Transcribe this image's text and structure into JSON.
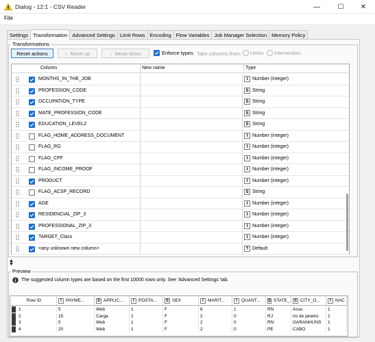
{
  "window": {
    "title": "Dialog - 12:1 - CSV Reader",
    "minimize_glyph": "—",
    "maximize_glyph": "☐",
    "close_glyph": "✕"
  },
  "menu": {
    "file": "File"
  },
  "tabs": [
    {
      "label": "Settings",
      "active": false
    },
    {
      "label": "Transformation",
      "active": true
    },
    {
      "label": "Advanced Settings",
      "active": false
    },
    {
      "label": "Limit Rows",
      "active": false
    },
    {
      "label": "Encoding",
      "active": false
    },
    {
      "label": "Flow Variables",
      "active": false
    },
    {
      "label": "Job Manager Selection",
      "active": false
    },
    {
      "label": "Memory Policy",
      "active": false
    }
  ],
  "transformations": {
    "group_label": "Transformations",
    "reset_label": "Reset actions",
    "move_up_label": "Move up",
    "move_down_label": "Move down",
    "enforce_types_label": "Enforce types",
    "enforce_types_checked": true,
    "take_columns_label": "Take columns from:",
    "union_label": "Union",
    "intersection_label": "Intersection"
  },
  "table": {
    "headers": {
      "column": "Column",
      "new_name": "New name",
      "type": "Type"
    },
    "rows": [
      {
        "checked": true,
        "column": "MONTHS_IN_THE_JOB",
        "type_icon": "I",
        "type": "Number (integer)"
      },
      {
        "checked": true,
        "column": "PROFESSION_CODE",
        "type_icon": "S",
        "type": "String"
      },
      {
        "checked": true,
        "column": "OCCUPATION_TYPE",
        "type_icon": "S",
        "type": "String"
      },
      {
        "checked": true,
        "column": "MATE_PROFESSION_CODE",
        "type_icon": "S",
        "type": "String"
      },
      {
        "checked": true,
        "column": "EDUCATION_LEVEL2",
        "type_icon": "S",
        "type": "String"
      },
      {
        "checked": false,
        "column": "FLAG_HOME_ADDRESS_DOCUMENT",
        "type_icon": "I",
        "type": "Number (integer)"
      },
      {
        "checked": false,
        "column": "FLAG_RG",
        "type_icon": "I",
        "type": "Number (integer)"
      },
      {
        "checked": false,
        "column": "FLAG_CPF",
        "type_icon": "I",
        "type": "Number (integer)"
      },
      {
        "checked": false,
        "column": "FLAG_INCOME_PROOF",
        "type_icon": "I",
        "type": "Number (integer)"
      },
      {
        "checked": true,
        "column": "PRODUCT",
        "type_icon": "I",
        "type": "Number (integer)"
      },
      {
        "checked": false,
        "column": "FLAG_ACSP_RECORD",
        "type_icon": "S",
        "type": "String"
      },
      {
        "checked": true,
        "column": "AGE",
        "type_icon": "I",
        "type": "Number (integer)"
      },
      {
        "checked": true,
        "column": "RESIDENCIAL_ZIP_3",
        "type_icon": "I",
        "type": "Number (integer)"
      },
      {
        "checked": true,
        "column": "PROFESSIONAL_ZIP_3",
        "type_icon": "I",
        "type": "Number (integer)"
      },
      {
        "checked": true,
        "column": "TARGET_Class",
        "type_icon": "I",
        "type": "Number (integer)"
      },
      {
        "checked": true,
        "column": "<any unknown new column>",
        "type_icon": "?",
        "type": "Default"
      }
    ]
  },
  "preview": {
    "group_label": "Preview",
    "info_text": "The suggested column types are based on the first 10000 rows only. See 'Advanced Settings' tab.",
    "headers": [
      {
        "icon": "",
        "label": "Row ID"
      },
      {
        "icon": "I",
        "label": "PAYME..."
      },
      {
        "icon": "S",
        "label": "APPLIC..."
      },
      {
        "icon": "I",
        "label": "POSTA..."
      },
      {
        "icon": "S",
        "label": "SEX"
      },
      {
        "icon": "I",
        "label": "MARIT..."
      },
      {
        "icon": "I",
        "label": "QUANT..."
      },
      {
        "icon": "S",
        "label": "STATE_..."
      },
      {
        "icon": "S",
        "label": "CITY_O..."
      },
      {
        "icon": "I",
        "label": "NAC"
      }
    ],
    "rows": [
      [
        "1",
        "5",
        "Web",
        "1",
        "F",
        "6",
        "1",
        "RN",
        "Assu",
        "1"
      ],
      [
        "2",
        "15",
        "Carga",
        "1",
        "F",
        "2",
        "0",
        "RJ",
        "rio de janeiro",
        "1"
      ],
      [
        "3",
        "5",
        "Web",
        "1",
        "F",
        "2",
        "0",
        "RN",
        "GARANHUNS",
        "1"
      ],
      [
        "4",
        "20",
        "Web",
        "1",
        "F",
        "2",
        "0",
        "PE",
        "CABO",
        "1"
      ]
    ]
  }
}
